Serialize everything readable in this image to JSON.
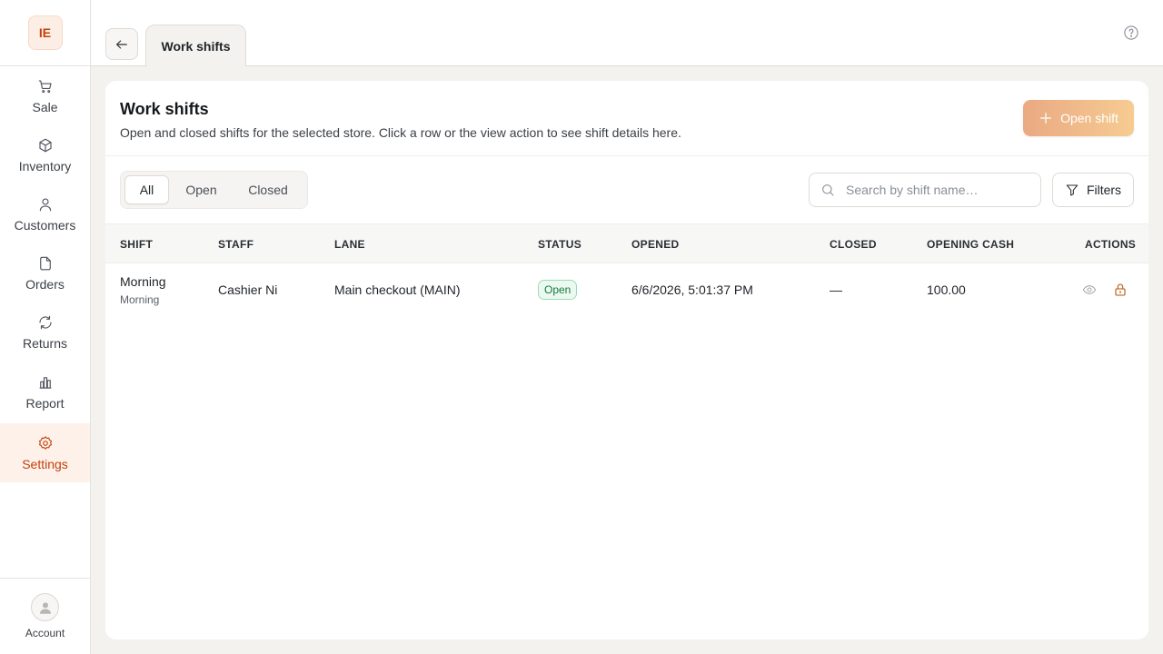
{
  "sidebar": {
    "logo": "IE",
    "items": [
      {
        "label": "Sale",
        "icon": "cart-icon"
      },
      {
        "label": "Inventory",
        "icon": "box-icon"
      },
      {
        "label": "Customers",
        "icon": "person-icon"
      },
      {
        "label": "Orders",
        "icon": "document-icon"
      },
      {
        "label": "Returns",
        "icon": "refresh-icon"
      },
      {
        "label": "Report",
        "icon": "bar-chart-icon"
      },
      {
        "label": "Settings",
        "icon": "gear-icon",
        "active": true
      }
    ],
    "account_label": "Account"
  },
  "topbar": {
    "tab_label": "Work shifts"
  },
  "page": {
    "title": "Work shifts",
    "subtitle": "Open and closed shifts for the selected store. Click a row or the view action to see shift details here.",
    "open_shift_label": "Open shift",
    "filter_tabs": [
      "All",
      "Open",
      "Closed"
    ],
    "active_filter": "All",
    "search_placeholder": "Search by shift name…",
    "filters_label": "Filters"
  },
  "table": {
    "columns": [
      "SHIFT",
      "STAFF",
      "LANE",
      "STATUS",
      "OPENED",
      "CLOSED",
      "OPENING CASH",
      "ACTIONS"
    ],
    "rows": [
      {
        "shift": "Morning",
        "shift_sub": "Morning",
        "staff": "Cashier Ni",
        "lane": "Main checkout (MAIN)",
        "status": "Open",
        "opened": "6/6/2026, 5:01:37 PM",
        "closed": "—",
        "opening_cash": "100.00"
      }
    ]
  },
  "colors": {
    "accent": "#c2410c",
    "status_open": "#137a3e"
  }
}
